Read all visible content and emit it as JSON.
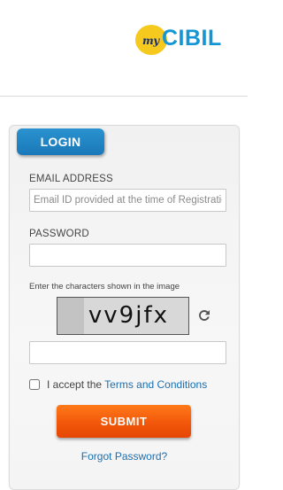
{
  "header": {
    "logo": {
      "prefix": "my",
      "name": "CIBIL",
      "colors": {
        "circle": "#f6c91f",
        "prefix": "#1a2f6b",
        "name": "#1596d4"
      }
    }
  },
  "login": {
    "tab_label": "LOGIN",
    "email_label": "EMAIL ADDRESS",
    "email_placeholder": "Email ID provided at the time of Registration",
    "email_value": "",
    "password_label": "PASSWORD",
    "password_value": "",
    "captcha_instruction": "Enter the characters shown in the image",
    "captcha_text": "vv9jfx",
    "captcha_value": "",
    "refresh_icon": "refresh-icon",
    "accept_prefix": "I accept the ",
    "terms_link": "Terms and Conditions",
    "accept_checked": false,
    "submit_label": "SUBMIT",
    "forgot_password": "Forgot Password?"
  },
  "colors": {
    "tab_blue": "#1f84c4",
    "submit_orange": "#f2570a",
    "link_blue": "#1a6fb0"
  }
}
